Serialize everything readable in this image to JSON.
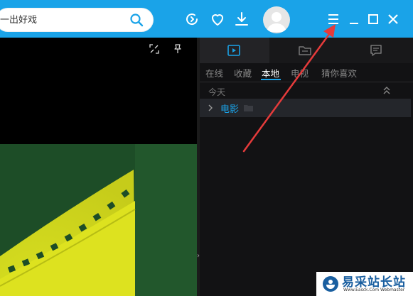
{
  "search": {
    "placeholder": "一出好戏"
  },
  "right_panel": {
    "text_tabs": [
      "在线",
      "收藏",
      "本地",
      "电视",
      "猜你喜欢"
    ],
    "active_tab": "本地",
    "section_title": "今天",
    "folder": {
      "name": "电影"
    }
  },
  "watermark": {
    "text": "易采站长站",
    "sub": "Www.Easck.Com  Webmaster"
  },
  "colors": {
    "accent": "#1aa3e8",
    "annotation_arrow": "#e53b3b"
  },
  "icons": [
    "search-icon",
    "refresh-icon",
    "heart-icon",
    "download-icon",
    "avatar",
    "menu-icon",
    "minimize-icon",
    "maximize-icon",
    "close-icon",
    "expand-icon",
    "pin-icon",
    "playlist-icon",
    "folder-tab-icon",
    "message-icon",
    "collapse-up-icon",
    "chevron-right-icon",
    "folder-icon"
  ]
}
